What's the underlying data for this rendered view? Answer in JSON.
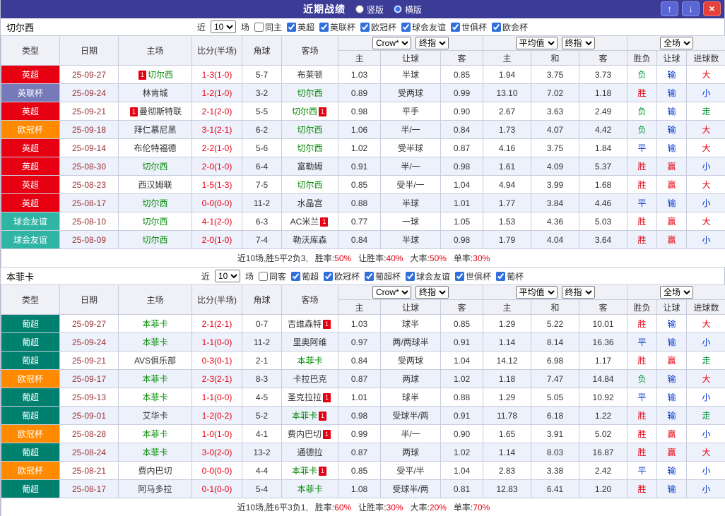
{
  "title_bar": {
    "title": "近期战绩",
    "radio_vertical": "竖版",
    "radio_horizontal": "横版",
    "selected": "横版",
    "up_icon": "↑",
    "down_icon": "↓",
    "close_icon": "×"
  },
  "colors": {
    "titlebar_bg": "#3c3c96",
    "league_map": {
      "英超": "#e60012",
      "英联杯": "#767ab8",
      "欧冠杯": "#ff8a00",
      "球会友谊": "#30b4a4",
      "葡超": "#00806f"
    },
    "result_map": {
      "胜": "#e60012",
      "赢": "#e60012",
      "大": "#e60012",
      "平": "#0033cc",
      "输": "#0033cc",
      "小": "#0033cc",
      "负": "#009933",
      "走": "#009933"
    },
    "focus_team": "#008800"
  },
  "sections": [
    {
      "team": "切尔西",
      "filter": {
        "near_label": "近",
        "count": "10",
        "unit_label": "场",
        "checkboxes": [
          {
            "label": "同主",
            "checked": false
          },
          {
            "label": "英超",
            "checked": true
          },
          {
            "label": "英联杯",
            "checked": true
          },
          {
            "label": "欧冠杯",
            "checked": true
          },
          {
            "label": "球会友谊",
            "checked": true
          },
          {
            "label": "世俱杯",
            "checked": true
          },
          {
            "label": "欧会杯",
            "checked": true
          }
        ]
      },
      "header": {
        "book": "Crow*",
        "book_time": "终指",
        "avg": "平均值",
        "avg_time": "终指",
        "scope": "全场",
        "columns": [
          "类型",
          "日期",
          "主场",
          "比分(半场)",
          "角球",
          "客场",
          "主",
          "让球",
          "客",
          "主",
          "和",
          "客",
          "胜负",
          "让球",
          "进球数"
        ]
      },
      "rows": [
        {
          "league": "英超",
          "date": "25-09-27",
          "home": {
            "name": "切尔西",
            "focus": true,
            "card": "before"
          },
          "score": "1-3(1-0)",
          "corners": "5-7",
          "away": {
            "name": "布莱顿"
          },
          "asia": [
            "1.03",
            "半球",
            "0.85"
          ],
          "avg": [
            "1.94",
            "3.75",
            "3.73"
          ],
          "res": [
            "负",
            "输",
            "大"
          ]
        },
        {
          "league": "英联杯",
          "date": "25-09-24",
          "home": {
            "name": "林肯城"
          },
          "score": "1-2(1-0)",
          "corners": "3-2",
          "away": {
            "name": "切尔西",
            "focus": true
          },
          "asia": [
            "0.89",
            "受两球",
            "0.99"
          ],
          "avg": [
            "13.10",
            "7.02",
            "1.18"
          ],
          "res": [
            "胜",
            "输",
            "小"
          ]
        },
        {
          "league": "英超",
          "date": "25-09-21",
          "home": {
            "name": "曼彻斯特联",
            "card": "before"
          },
          "score": "2-1(2-0)",
          "corners": "5-5",
          "away": {
            "name": "切尔西",
            "focus": true,
            "card": "after"
          },
          "asia": [
            "0.98",
            "平手",
            "0.90"
          ],
          "avg": [
            "2.67",
            "3.63",
            "2.49"
          ],
          "res": [
            "负",
            "输",
            "走"
          ]
        },
        {
          "league": "欧冠杯",
          "date": "25-09-18",
          "home": {
            "name": "拜仁慕尼黑"
          },
          "score": "3-1(2-1)",
          "corners": "6-2",
          "away": {
            "name": "切尔西",
            "focus": true
          },
          "asia": [
            "1.06",
            "半/一",
            "0.84"
          ],
          "avg": [
            "1.73",
            "4.07",
            "4.42"
          ],
          "res": [
            "负",
            "输",
            "大"
          ]
        },
        {
          "league": "英超",
          "date": "25-09-14",
          "home": {
            "name": "布伦特福德"
          },
          "score": "2-2(1-0)",
          "corners": "5-6",
          "away": {
            "name": "切尔西",
            "focus": true
          },
          "asia": [
            "1.02",
            "受半球",
            "0.87"
          ],
          "avg": [
            "4.16",
            "3.75",
            "1.84"
          ],
          "res": [
            "平",
            "输",
            "大"
          ]
        },
        {
          "league": "英超",
          "date": "25-08-30",
          "home": {
            "name": "切尔西",
            "focus": true
          },
          "score": "2-0(1-0)",
          "corners": "6-4",
          "away": {
            "name": "富勒姆"
          },
          "asia": [
            "0.91",
            "半/一",
            "0.98"
          ],
          "avg": [
            "1.61",
            "4.09",
            "5.37"
          ],
          "res": [
            "胜",
            "赢",
            "小"
          ]
        },
        {
          "league": "英超",
          "date": "25-08-23",
          "home": {
            "name": "西汉姆联"
          },
          "score": "1-5(1-3)",
          "corners": "7-5",
          "away": {
            "name": "切尔西",
            "focus": true
          },
          "asia": [
            "0.85",
            "受半/一",
            "1.04"
          ],
          "avg": [
            "4.94",
            "3.99",
            "1.68"
          ],
          "res": [
            "胜",
            "赢",
            "大"
          ]
        },
        {
          "league": "英超",
          "date": "25-08-17",
          "home": {
            "name": "切尔西",
            "focus": true
          },
          "score": "0-0(0-0)",
          "corners": "11-2",
          "away": {
            "name": "水晶宫"
          },
          "asia": [
            "0.88",
            "半球",
            "1.01"
          ],
          "avg": [
            "1.77",
            "3.84",
            "4.46"
          ],
          "res": [
            "平",
            "输",
            "小"
          ]
        },
        {
          "league": "球会友谊",
          "date": "25-08-10",
          "home": {
            "name": "切尔西",
            "focus": true
          },
          "score": "4-1(2-0)",
          "corners": "6-3",
          "away": {
            "name": "AC米兰",
            "card": "after"
          },
          "asia": [
            "0.77",
            "一球",
            "1.05"
          ],
          "avg": [
            "1.53",
            "4.36",
            "5.03"
          ],
          "res": [
            "胜",
            "赢",
            "大"
          ]
        },
        {
          "league": "球会友谊",
          "date": "25-08-09",
          "home": {
            "name": "切尔西",
            "focus": true
          },
          "score": "2-0(1-0)",
          "corners": "7-4",
          "away": {
            "name": "勒沃库森"
          },
          "asia": [
            "0.84",
            "半球",
            "0.98"
          ],
          "avg": [
            "1.79",
            "4.04",
            "3.64"
          ],
          "res": [
            "胜",
            "赢",
            "小"
          ]
        }
      ],
      "summary": {
        "prefix": "近10场,胜5平2负3,",
        "stats": [
          {
            "label": "胜率:",
            "value": "50%"
          },
          {
            "label": "让胜率:",
            "value": "40%"
          },
          {
            "label": "大率:",
            "value": "50%"
          },
          {
            "label": "单率:",
            "value": "30%"
          }
        ]
      }
    },
    {
      "team": "本菲卡",
      "filter": {
        "near_label": "近",
        "count": "10",
        "unit_label": "场",
        "checkboxes": [
          {
            "label": "同客",
            "checked": false
          },
          {
            "label": "葡超",
            "checked": true
          },
          {
            "label": "欧冠杯",
            "checked": true
          },
          {
            "label": "葡超杯",
            "checked": true
          },
          {
            "label": "球会友谊",
            "checked": true
          },
          {
            "label": "世俱杯",
            "checked": true
          },
          {
            "label": "葡杯",
            "checked": true
          }
        ]
      },
      "header": {
        "book": "Crow*",
        "book_time": "终指",
        "avg": "平均值",
        "avg_time": "终指",
        "scope": "全场",
        "columns": [
          "类型",
          "日期",
          "主场",
          "比分(半场)",
          "角球",
          "客场",
          "主",
          "让球",
          "客",
          "主",
          "和",
          "客",
          "胜负",
          "让球",
          "进球数"
        ]
      },
      "rows": [
        {
          "league": "葡超",
          "date": "25-09-27",
          "home": {
            "name": "本菲卡",
            "focus": true
          },
          "score": "2-1(2-1)",
          "corners": "0-7",
          "away": {
            "name": "吉维森特",
            "card": "after"
          },
          "asia": [
            "1.03",
            "球半",
            "0.85"
          ],
          "avg": [
            "1.29",
            "5.22",
            "10.01"
          ],
          "res": [
            "胜",
            "输",
            "大"
          ]
        },
        {
          "league": "葡超",
          "date": "25-09-24",
          "home": {
            "name": "本菲卡",
            "focus": true
          },
          "score": "1-1(0-0)",
          "corners": "11-2",
          "away": {
            "name": "里奥阿维"
          },
          "asia": [
            "0.97",
            "两/两球半",
            "0.91"
          ],
          "avg": [
            "1.14",
            "8.14",
            "16.36"
          ],
          "res": [
            "平",
            "输",
            "小"
          ]
        },
        {
          "league": "葡超",
          "date": "25-09-21",
          "home": {
            "name": "AVS俱乐部"
          },
          "score": "0-3(0-1)",
          "corners": "2-1",
          "away": {
            "name": "本菲卡",
            "focus": true
          },
          "asia": [
            "0.84",
            "受两球",
            "1.04"
          ],
          "avg": [
            "14.12",
            "6.98",
            "1.17"
          ],
          "res": [
            "胜",
            "赢",
            "走"
          ]
        },
        {
          "league": "欧冠杯",
          "date": "25-09-17",
          "home": {
            "name": "本菲卡",
            "focus": true
          },
          "score": "2-3(2-1)",
          "corners": "8-3",
          "away": {
            "name": "卡拉巴克"
          },
          "asia": [
            "0.87",
            "两球",
            "1.02"
          ],
          "avg": [
            "1.18",
            "7.47",
            "14.84"
          ],
          "res": [
            "负",
            "输",
            "大"
          ]
        },
        {
          "league": "葡超",
          "date": "25-09-13",
          "home": {
            "name": "本菲卡",
            "focus": true
          },
          "score": "1-1(0-0)",
          "corners": "4-5",
          "away": {
            "name": "圣克拉拉",
            "card": "after"
          },
          "asia": [
            "1.01",
            "球半",
            "0.88"
          ],
          "avg": [
            "1.29",
            "5.05",
            "10.92"
          ],
          "res": [
            "平",
            "输",
            "小"
          ]
        },
        {
          "league": "葡超",
          "date": "25-09-01",
          "home": {
            "name": "艾华卡"
          },
          "score": "1-2(0-2)",
          "corners": "5-2",
          "away": {
            "name": "本菲卡",
            "focus": true,
            "card": "after"
          },
          "asia": [
            "0.98",
            "受球半/两",
            "0.91"
          ],
          "avg": [
            "11.78",
            "6.18",
            "1.22"
          ],
          "res": [
            "胜",
            "输",
            "走"
          ]
        },
        {
          "league": "欧冠杯",
          "date": "25-08-28",
          "home": {
            "name": "本菲卡",
            "focus": true
          },
          "score": "1-0(1-0)",
          "corners": "4-1",
          "away": {
            "name": "费内巴切",
            "card": "after"
          },
          "asia": [
            "0.99",
            "半/一",
            "0.90"
          ],
          "avg": [
            "1.65",
            "3.91",
            "5.02"
          ],
          "res": [
            "胜",
            "赢",
            "小"
          ]
        },
        {
          "league": "葡超",
          "date": "25-08-24",
          "home": {
            "name": "本菲卡",
            "focus": true
          },
          "score": "3-0(2-0)",
          "corners": "13-2",
          "away": {
            "name": "通德拉"
          },
          "asia": [
            "0.87",
            "两球",
            "1.02"
          ],
          "avg": [
            "1.14",
            "8.03",
            "16.87"
          ],
          "res": [
            "胜",
            "赢",
            "大"
          ]
        },
        {
          "league": "欧冠杯",
          "date": "25-08-21",
          "home": {
            "name": "费内巴切"
          },
          "score": "0-0(0-0)",
          "corners": "4-4",
          "away": {
            "name": "本菲卡",
            "focus": true,
            "card": "after"
          },
          "asia": [
            "0.85",
            "受平/半",
            "1.04"
          ],
          "avg": [
            "2.83",
            "3.38",
            "2.42"
          ],
          "res": [
            "平",
            "输",
            "小"
          ]
        },
        {
          "league": "葡超",
          "date": "25-08-17",
          "home": {
            "name": "阿马多拉"
          },
          "score": "0-1(0-0)",
          "corners": "5-4",
          "away": {
            "name": "本菲卡",
            "focus": true
          },
          "asia": [
            "1.08",
            "受球半/两",
            "0.81"
          ],
          "avg": [
            "12.83",
            "6.41",
            "1.20"
          ],
          "res": [
            "胜",
            "输",
            "小"
          ]
        }
      ],
      "summary": {
        "prefix": "近10场,胜6平3负1,",
        "stats": [
          {
            "label": "胜率:",
            "value": "60%"
          },
          {
            "label": "让胜率:",
            "value": "30%"
          },
          {
            "label": "大率:",
            "value": "20%"
          },
          {
            "label": "单率:",
            "value": "70%"
          }
        ]
      }
    }
  ]
}
